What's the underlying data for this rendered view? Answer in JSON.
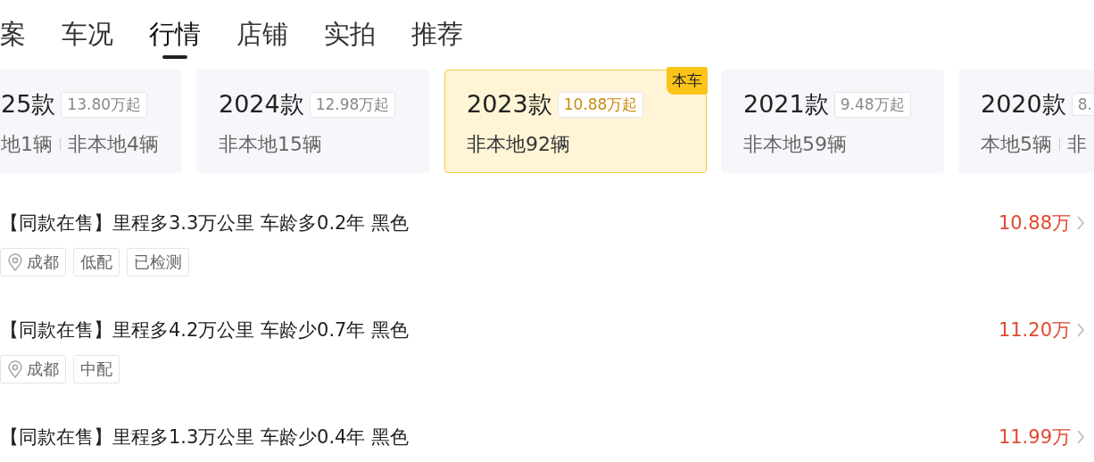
{
  "tabs": [
    {
      "label": "案",
      "selected": false
    },
    {
      "label": "车况",
      "selected": false
    },
    {
      "label": "行情",
      "selected": true
    },
    {
      "label": "店铺",
      "selected": false
    },
    {
      "label": "实拍",
      "selected": false
    },
    {
      "label": "推荐",
      "selected": false
    }
  ],
  "year_cards": [
    {
      "year": "25款",
      "price": "13.80万起",
      "counts": [
        "地1辆",
        "非本地4辆"
      ],
      "selected": false
    },
    {
      "year": "2024款",
      "price": "12.98万起",
      "counts": [
        "非本地15辆"
      ],
      "selected": false
    },
    {
      "year": "2023款",
      "price": "10.88万起",
      "counts": [
        "非本地92辆"
      ],
      "selected": true,
      "badge": "本车"
    },
    {
      "year": "2021款",
      "price": "9.48万起",
      "counts": [
        "非本地59辆"
      ],
      "selected": false
    },
    {
      "year": "2020款",
      "price": "8.",
      "counts": [
        "本地5辆",
        "非"
      ],
      "selected": false
    }
  ],
  "listings": [
    {
      "title": "【同款在售】里程多3.3万公里 车龄多0.2年 黑色",
      "price": "10.88万",
      "tags": [
        {
          "kind": "location",
          "label": "成都"
        },
        {
          "kind": "plain",
          "label": "低配"
        },
        {
          "kind": "plain",
          "label": "已检测"
        }
      ]
    },
    {
      "title": "【同款在售】里程多4.2万公里 车龄少0.7年 黑色",
      "price": "11.20万",
      "tags": [
        {
          "kind": "location",
          "label": "成都"
        },
        {
          "kind": "plain",
          "label": "中配"
        }
      ]
    },
    {
      "title": "【同款在售】里程多1.3万公里 车龄少0.4年 黑色",
      "price": "11.99万"
    }
  ]
}
